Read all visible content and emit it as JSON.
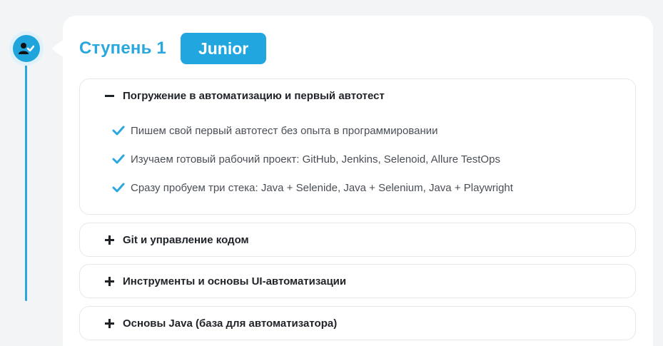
{
  "step": {
    "title": "Ступень 1",
    "level": "Junior",
    "icon": "user-check-icon"
  },
  "accordion": [
    {
      "title": "Погружение в автоматизацию и первый автотест",
      "expanded": true,
      "items": [
        "Пишем свой первый автотест без опыта в программировании",
        "Изучаем готовый рабочий проект: GitHub, Jenkins, Selenoid, Allure TestOps",
        "Сразу пробуем три стека: Java + Selenide, Java + Selenium, Java + Playwright"
      ]
    },
    {
      "title": "Git и управление кодом",
      "expanded": false
    },
    {
      "title": "Инструменты и основы UI-автоматизации",
      "expanded": false
    },
    {
      "title": "Основы Java (база для автоматизатора)",
      "expanded": false
    }
  ],
  "colors": {
    "accent": "#22a6df",
    "check": "#2aa8de",
    "background": "#f3f4f6"
  }
}
